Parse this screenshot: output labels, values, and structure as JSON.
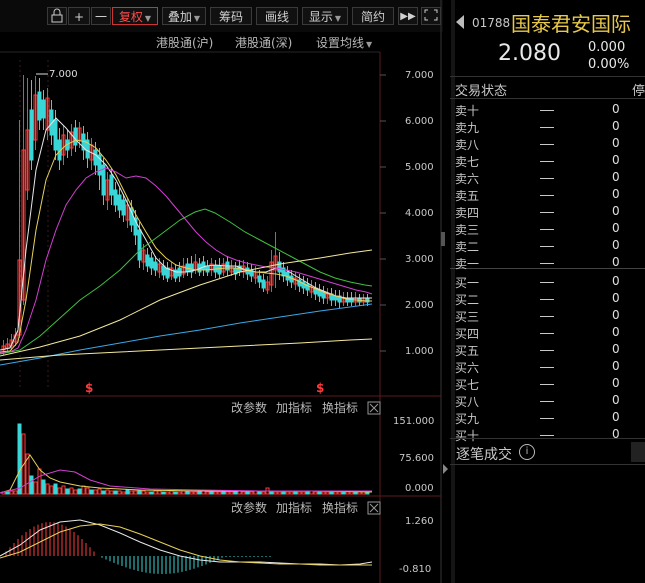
{
  "toolbar": {
    "buttons": [
      "+",
      "一",
      "复权",
      "叠加",
      "筹码",
      "画线",
      "显示",
      "简约"
    ],
    "restore_label": "复权",
    "overlay_label": "叠加",
    "chips_label": "筹码",
    "draw_label": "画线",
    "display_label": "显示",
    "simple_label": "简约"
  },
  "subheader": {
    "sh_connect": "港股通(沪)",
    "sz_connect": "港股通(深)",
    "ma_settings": "设置均线"
  },
  "price_axis": [
    "7.000",
    "6.000",
    "5.000",
    "4.000",
    "3.000",
    "2.000",
    "1.000"
  ],
  "volume_axis": [
    "151.000",
    "75.600",
    "0.000"
  ],
  "macd_axis": [
    "1.260",
    "-0.810"
  ],
  "peak_label": "7.000",
  "indicator_panel_1": {
    "params": "改参数",
    "add": "加指标",
    "switch": "换指标"
  },
  "indicator_panel_2": {
    "params": "改参数",
    "add": "加指标",
    "switch": "换指标"
  },
  "markers": [
    "$",
    "$"
  ],
  "quote": {
    "code": "01788",
    "name": "国泰君安国际",
    "price": "2.080",
    "change": "0.000",
    "change_pct": "0.00%",
    "trade_status_label": "交易状态",
    "trade_status_value": "停",
    "ask_labels": [
      "卖十",
      "卖九",
      "卖八",
      "卖七",
      "卖六",
      "卖五",
      "卖四",
      "卖三",
      "卖二",
      "卖一"
    ],
    "bid_labels": [
      "买一",
      "买二",
      "买三",
      "买四",
      "买五",
      "买六",
      "买七",
      "买八",
      "买九",
      "买十"
    ],
    "level_value": "0",
    "trades_label": "逐笔成交"
  },
  "colors": {
    "up": "#ff3b3b",
    "down": "#38d6d6",
    "accent": "#d9c24a"
  }
}
